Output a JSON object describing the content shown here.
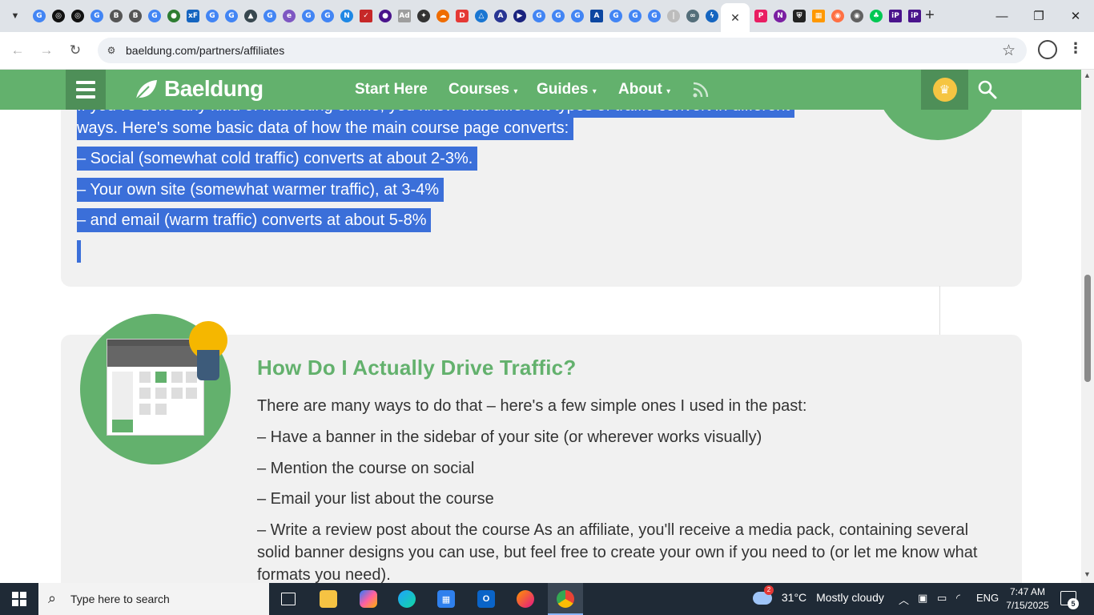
{
  "browser": {
    "url": "baeldung.com/partners/affiliates",
    "active_tab_close": "✕",
    "new_tab": "+",
    "minimize": "—",
    "restore": "❐",
    "close": "✕",
    "back": "←",
    "forward": "→",
    "reload": "↻",
    "star": "☆",
    "menu": "⋮"
  },
  "site": {
    "logo": "Baeldung",
    "nav": [
      {
        "label": "Start Here",
        "dropdown": false
      },
      {
        "label": "Courses",
        "dropdown": true
      },
      {
        "label": "Guides",
        "dropdown": true
      },
      {
        "label": "About",
        "dropdown": true
      }
    ],
    "caret": "▾",
    "accent_color": "#63b16d"
  },
  "article": {
    "selected_lines": [
      "If you've done any kind of marketing online, you know that different types of traffic convert in different",
      "ways. Here's some basic data of how the main course page converts:",
      "– Social (somewhat cold traffic) converts at about 2-3%.",
      "– Your own site (somewhat warmer traffic), at 3-4%",
      "–  and email (warm traffic) converts at about 5-8%"
    ],
    "section_title": "How Do I Actually Drive Traffic?",
    "paragraphs": [
      "There are many ways to do that – here's a few simple ones I used in the past:",
      "– Have a banner in the sidebar of your site (or wherever works visually)",
      "– Mention the course on social",
      "– Email your list about the course",
      "– Write a review post about the course As an affiliate, you'll receive a media pack, containing several",
      "solid banner designs you can use, but feel free to create your own if you need to (or let me know what",
      "formats you need)."
    ]
  },
  "taskbar": {
    "search_placeholder": "Type here to search",
    "weather_temp": "31°C",
    "weather_desc": "Mostly cloudy",
    "weather_badge": "2",
    "language": "ENG",
    "time": "7:47 AM",
    "date": "7/15/2025",
    "notification_count": "5"
  }
}
